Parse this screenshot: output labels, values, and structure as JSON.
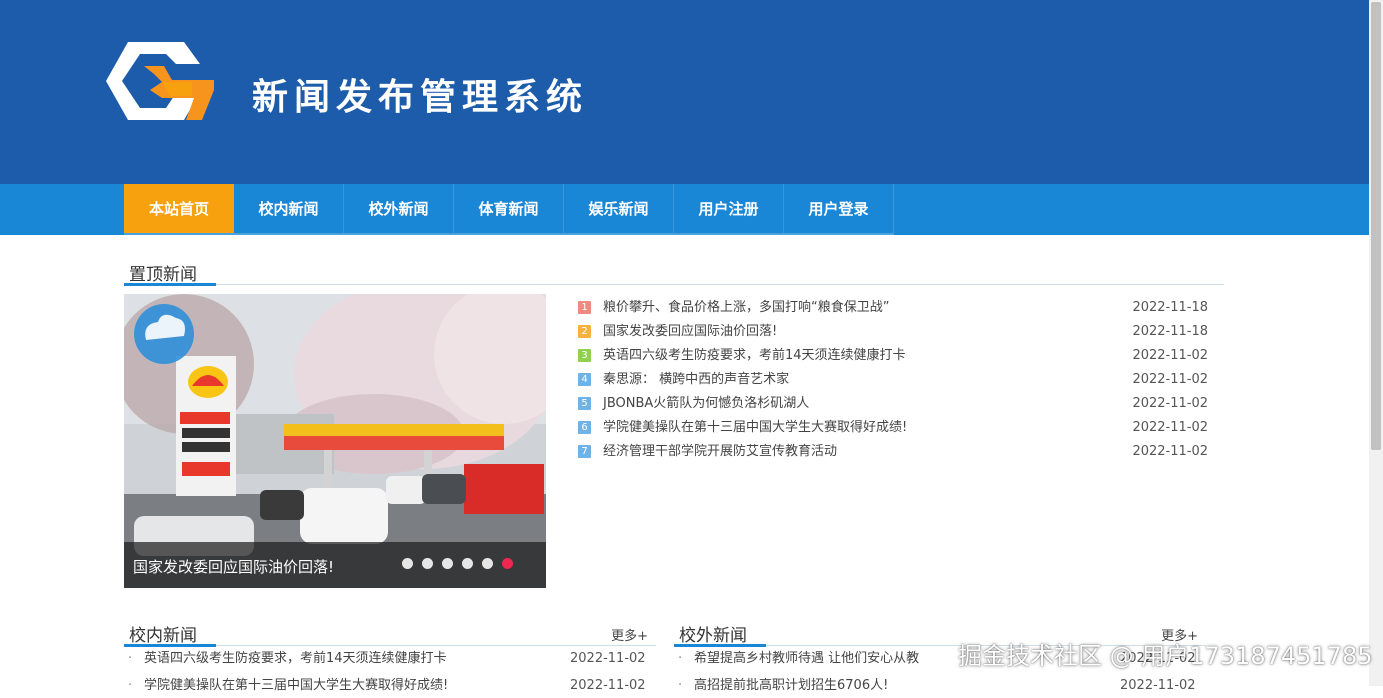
{
  "header": {
    "site_title": "新闻发布管理系统",
    "bg_color": "#1c5cab"
  },
  "nav": {
    "items": [
      {
        "label": "本站首页",
        "active": true
      },
      {
        "label": "校内新闻"
      },
      {
        "label": "校外新闻"
      },
      {
        "label": "体育新闻"
      },
      {
        "label": "娱乐新闻"
      },
      {
        "label": "用户注册"
      },
      {
        "label": "用户登录"
      }
    ],
    "bg_color": "#1a86d6",
    "active_color": "#f7a10f"
  },
  "pinned": {
    "title": "置顶新闻",
    "slider": {
      "caption": "国家发改委回应国际油价回落!",
      "dot_count": 6,
      "active_dot": 6
    },
    "items": [
      {
        "num": "1",
        "title": "粮价攀升、食品价格上涨，多国打响“粮食保卫战”",
        "date": "2022-11-18",
        "color": "#f08a7e"
      },
      {
        "num": "2",
        "title": "国家发改委回应国际油价回落!",
        "date": "2022-11-18",
        "color": "#f7b23b"
      },
      {
        "num": "3",
        "title": "英语四六级考生防疫要求，考前14天须连续健康打卡",
        "date": "2022-11-02",
        "color": "#8fd14f"
      },
      {
        "num": "4",
        "title": "秦思源： 横跨中西的声音艺术家",
        "date": "2022-11-02",
        "color": "#6eb3e8"
      },
      {
        "num": "5",
        "title": "JBONBA火箭队为何憾负洛杉矶湖人",
        "date": "2022-11-02",
        "color": "#6eb3e8"
      },
      {
        "num": "6",
        "title": "学院健美操队在第十三届中国大学生大赛取得好成绩!",
        "date": "2022-11-02",
        "color": "#6eb3e8"
      },
      {
        "num": "7",
        "title": "经济管理干部学院开展防艾宣传教育活动",
        "date": "2022-11-02",
        "color": "#6eb3e8"
      }
    ]
  },
  "campus": {
    "title": "校内新闻",
    "more": "更多+",
    "items": [
      {
        "title": "英语四六级考生防疫要求，考前14天须连续健康打卡",
        "date": "2022-11-02"
      },
      {
        "title": "学院健美操队在第十三届中国大学生大赛取得好成绩!",
        "date": "2022-11-02"
      }
    ]
  },
  "outside": {
    "title": "校外新闻",
    "more": "更多+",
    "items": [
      {
        "title": "希望提高乡村教师待遇 让他们安心从教",
        "date": "2022-11-02"
      },
      {
        "title": "高招提前批高职计划招生6706人!",
        "date": "2022-11-02"
      }
    ]
  },
  "watermark": "掘金技术社区 @ 用户173187451785"
}
